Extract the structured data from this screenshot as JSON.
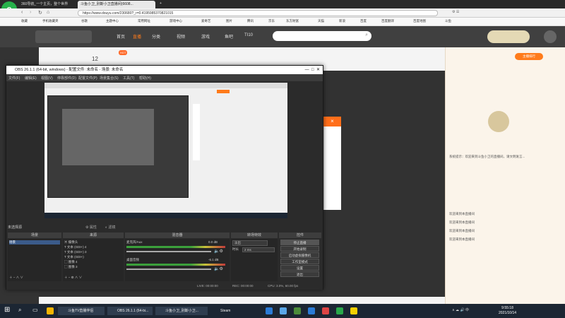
{
  "browser": {
    "tabs": [
      "360导航_一个主页，整个世界",
      "斗鱼小卫_别斯小卫直播间(6608..."
    ],
    "url": "https://www.douyu.com/230680?_r=0.4195985370821015",
    "bookmarks": [
      "收藏",
      "手机收藏夹",
      "谷歌",
      "主题中心",
      "常用网址",
      "游戏中心",
      "爱奇艺",
      "图片",
      "腾讯",
      "京东",
      "东方财富",
      "天猫",
      "新浪",
      "百度",
      "百度翻译",
      "百度地图",
      "斗鱼"
    ],
    "colors": {
      "accent": "#ff7b1a",
      "logo": "#27b14b"
    }
  },
  "site": {
    "nav": [
      "首页",
      "直播",
      "分类",
      "视频",
      "游戏",
      "鱼吧",
      "TI10"
    ],
    "live_count": "12",
    "sidebar_btn": "主播排行"
  },
  "obs": {
    "title": "OBS 26.1.1 (64-bit, windows) - 配置文件: 未命名 - 场景: 未命名",
    "menu": [
      "文件(F)",
      "编辑(E)",
      "视图(V)",
      "停靠部件(D)",
      "配置文件(P)",
      "场景集合(S)",
      "工具(T)",
      "帮助(H)"
    ],
    "no_source": "未选择源",
    "props": "属性",
    "filters": "滤镜",
    "docks": {
      "scenes": "场景",
      "sources": "来源",
      "mixer": "混音器",
      "transition": "转场特效",
      "controls": "控件"
    },
    "scene": "场景",
    "sources": [
      "摄像头",
      "文本 (GDI+) 4",
      "文本 (GDI+) 3",
      "文本 (GDI+)",
      "图像 4",
      "图像 3"
    ],
    "mixer": [
      {
        "name": "麦克风/Aux",
        "db": "0.0 dB"
      },
      {
        "name": "桌面音频",
        "db": "-6.1 dB"
      }
    ],
    "transition": {
      "type": "淡出",
      "duration_label": "时长",
      "duration": "2 ms"
    },
    "controls": [
      "停止直播",
      "开始录制",
      "启动虚拟摄像机",
      "工作室模式",
      "设置",
      "退出"
    ],
    "status": {
      "live": "LIVE: 00:00:00",
      "rec": "REC: 00:00:00",
      "cpu": "CPU: 3.0%, 60.00 fps"
    }
  },
  "chat": {
    "messages": [
      "系统提示：欢迎来到斗鱼小卫的直播间，请文明发言...",
      "欢迎来到本直播间",
      "欢迎来到本直播间",
      "欢迎来到本直播间",
      "欢迎来到本直播间"
    ]
  },
  "taskbar": {
    "items": [
      "斗鱼TV直播伴侣",
      "OBS 26.1.1 (64-bi...",
      "斗鱼小卫_别斯小卫...",
      "Steam"
    ],
    "time": "9:55:18",
    "date": "2021/10/14"
  }
}
